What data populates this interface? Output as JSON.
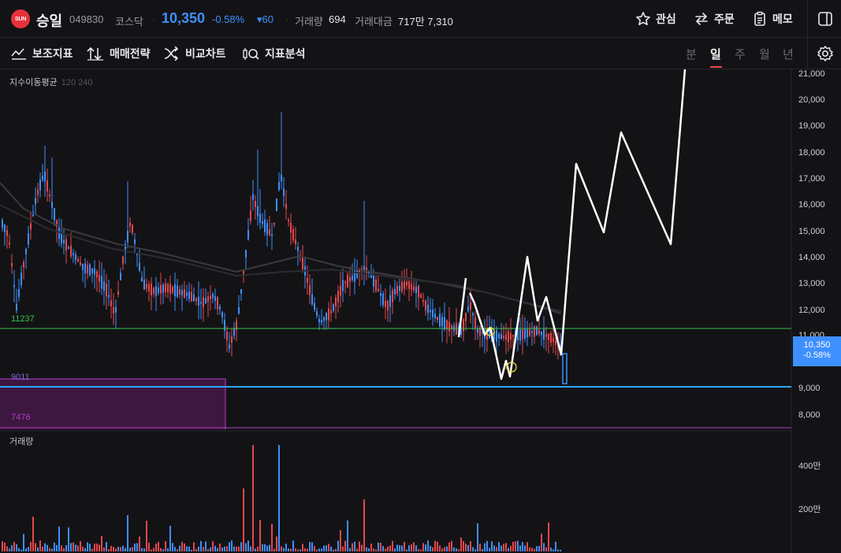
{
  "header": {
    "logo_text": "SUN",
    "name": "승일",
    "code": "049830",
    "market": "코스닥",
    "price": "10,350",
    "change_pct": "-0.58%",
    "change_amt": "▾60",
    "volume_label": "거래량",
    "volume_value": "694",
    "amount_label": "거래대금",
    "amount_value": "717만 7,310",
    "favorite_label": "관심",
    "order_label": "주문",
    "memo_label": "메모"
  },
  "toolbar": {
    "indicator_label": "보조지표",
    "strategy_label": "매매전략",
    "compare_label": "비교차트",
    "analysis_label": "지표분석",
    "timeframes": [
      "분",
      "일",
      "주",
      "월",
      "년"
    ],
    "active_timeframe": "일"
  },
  "chart": {
    "ma_legend_title": "지수이동평균",
    "ma_legend_periods": "120 240",
    "volume_title": "거래량",
    "price_axis_ticks": [
      "21,000",
      "20,000",
      "19,000",
      "18,000",
      "17,000",
      "16,000",
      "15,000",
      "14,000",
      "13,000",
      "12,000",
      "11,000",
      "9,000",
      "8,000"
    ],
    "volume_axis_ticks": [
      "400만",
      "200만"
    ],
    "current_price_label": "10,350",
    "current_change_label": "-0.58%",
    "level_green": "11237",
    "level_low": "9011",
    "level_box_low": "7476",
    "colors": {
      "up": "#e5484d",
      "down": "#3e8fff",
      "green_line": "#35c649",
      "blue_line": "#2aa7ff",
      "zone": "#3d1740",
      "zone_border": "#b43cc8",
      "drawing": "#ffffff",
      "marker": "#e8e22a"
    }
  }
}
